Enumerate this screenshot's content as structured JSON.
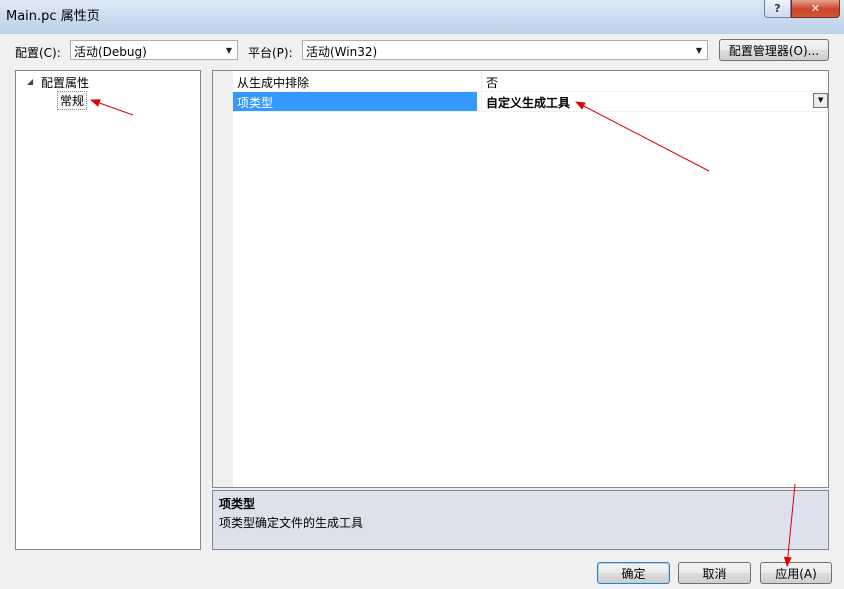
{
  "window": {
    "title": "Main.pc 属性页",
    "help_label": "?",
    "close_label": "✕"
  },
  "config_bar": {
    "config_label": "配置(C):",
    "config_value": "活动(Debug)",
    "platform_label": "平台(P):",
    "platform_value": "活动(Win32)",
    "manager_button": "配置管理器(O)..."
  },
  "tree": {
    "root": "配置属性",
    "children": [
      "常规"
    ]
  },
  "properties": [
    {
      "name": "从生成中排除",
      "value": "否"
    },
    {
      "name": "项类型",
      "value": "自定义生成工具",
      "selected": true
    }
  ],
  "description": {
    "title": "项类型",
    "text": "项类型确定文件的生成工具"
  },
  "footer": {
    "ok": "确定",
    "cancel": "取消",
    "apply": "应用(A)"
  },
  "colors": {
    "selection": "#3399ff",
    "annotation_arrow": "#e00000"
  }
}
